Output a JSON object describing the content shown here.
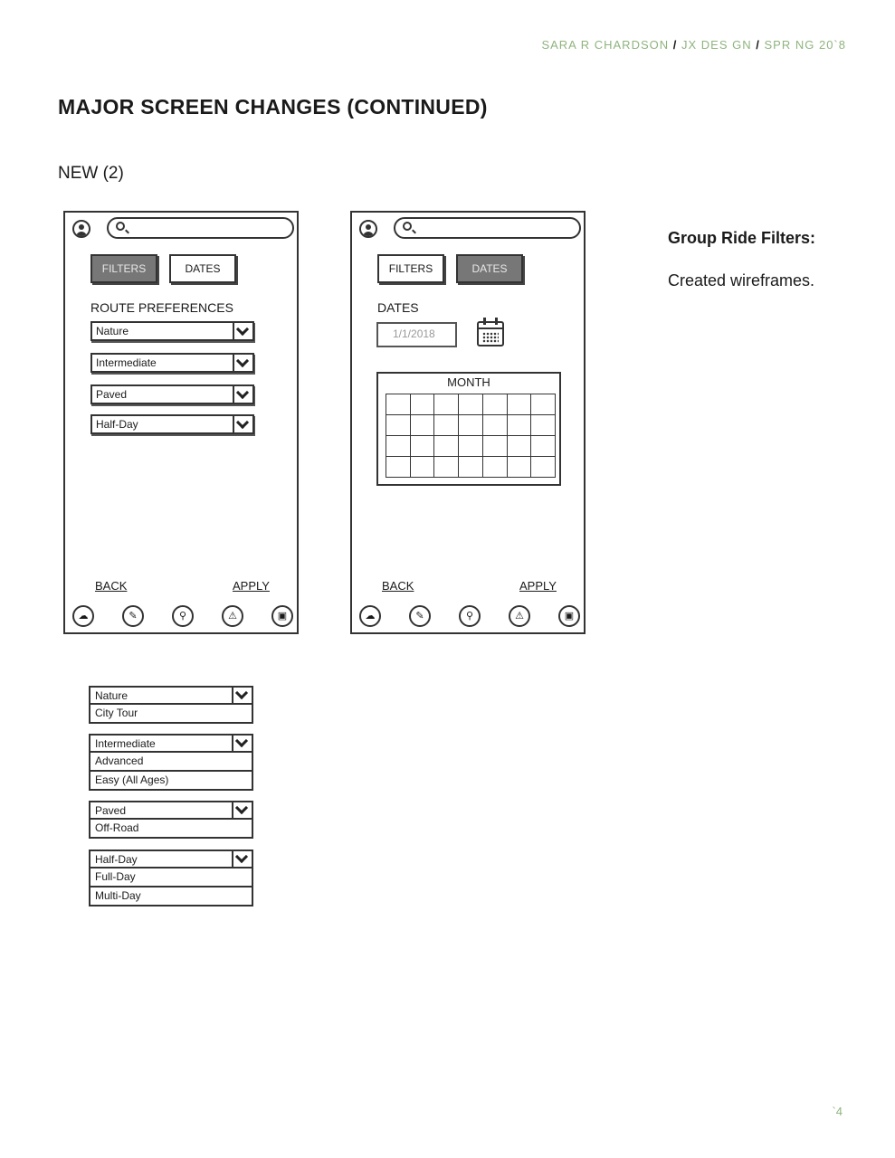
{
  "header": {
    "name": "SARA R CHARDSON",
    "sep1": "/",
    "course": "JX DES GN",
    "sep2": "/",
    "term": "SPR NG 20`8"
  },
  "page_title": "MAJOR SCREEN CHANGES (CONTINUED)",
  "section_label": "NEW (2)",
  "side_note": {
    "heading": "Group Ride Filters:",
    "body": "Created wireframes."
  },
  "page_number": "`4",
  "screen1": {
    "tabs": [
      "FILTERS",
      "DATES"
    ],
    "active_tab": "FILTERS",
    "section": "ROUTE PREFERENCES",
    "dropdowns": [
      "Nature",
      "Intermediate",
      "Paved",
      "Half-Day"
    ],
    "back": "BACK",
    "apply": "APPLY"
  },
  "screen2": {
    "tabs": [
      "FILTERS",
      "DATES"
    ],
    "active_tab": "DATES",
    "section": "DATES",
    "date_value": "1/1/2018",
    "calendar_title": "MONTH",
    "back": "BACK",
    "apply": "APPLY"
  },
  "nav_icons": [
    "weather-icon",
    "pin-icon",
    "bike-icon",
    "warning-icon",
    "bus-icon"
  ],
  "expanded_dropdowns": [
    {
      "selected": "Nature",
      "options": [
        "City Tour"
      ]
    },
    {
      "selected": "Intermediate",
      "options": [
        "Advanced",
        "Easy (All Ages)"
      ]
    },
    {
      "selected": "Paved",
      "options": [
        "Off-Road"
      ]
    },
    {
      "selected": "Half-Day",
      "options": [
        "Full-Day",
        "Multi-Day"
      ]
    }
  ]
}
